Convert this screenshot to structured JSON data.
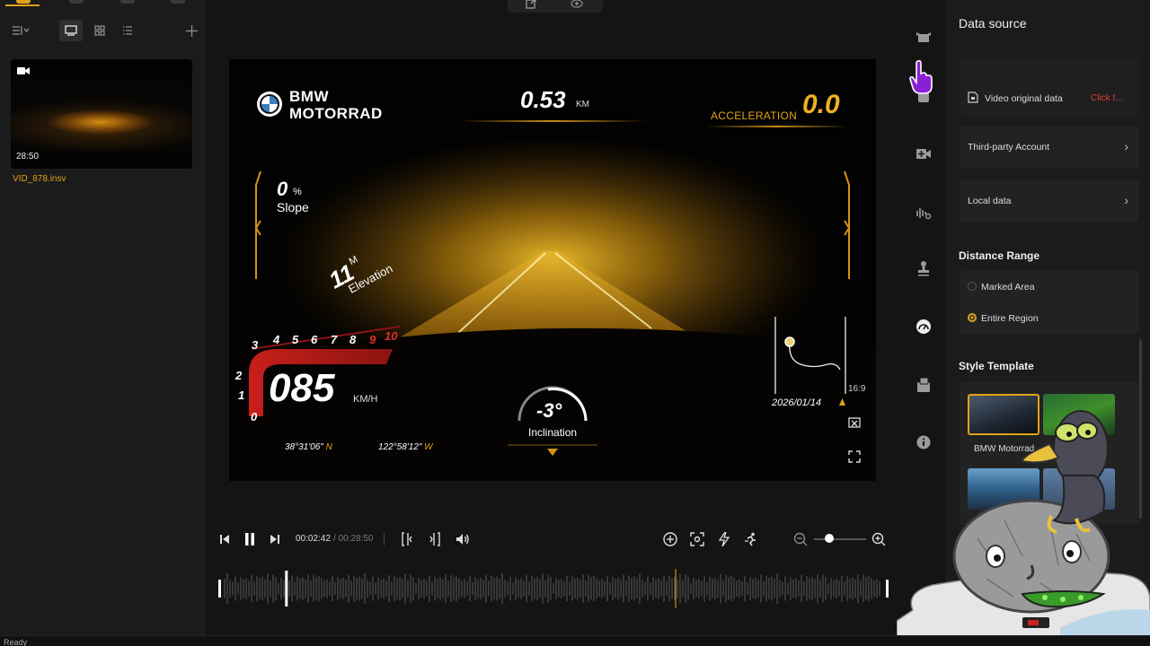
{
  "media_panel": {
    "clip": {
      "duration": "28:50",
      "filename": "VID_878.insv"
    }
  },
  "preview": {
    "brand_line1": "BMW",
    "brand_line2": "MOTORRAD",
    "distance": {
      "value": "0.53",
      "unit": "KM"
    },
    "acceleration": {
      "label": "ACCELERATION",
      "value": "0.0"
    },
    "slope": {
      "value": "0",
      "unit": "%",
      "label": "Slope"
    },
    "elevation": {
      "value": "11",
      "unit": "M",
      "label": "Elevation"
    },
    "speed": {
      "value": "085",
      "unit": "KM/H"
    },
    "gauge_ticks": [
      "0",
      "1",
      "2",
      "3",
      "4",
      "5",
      "6",
      "7",
      "8",
      "9",
      "10"
    ],
    "coordinates": {
      "lat": "38°31'06\"",
      "lat_dir": "N",
      "lon": "122°58'12\"",
      "lon_dir": "W"
    },
    "inclination": {
      "value": "-3°",
      "label": "Inclination"
    },
    "date": "2026/01/14",
    "aspect_ratio": "16:9"
  },
  "player": {
    "time_current": "00:02:42",
    "time_total": "/ 00:28:50",
    "progress": 0.094,
    "zoom_level": 0.3
  },
  "settings": {
    "data_source_title": "Data source",
    "video_original_data": {
      "label": "Video original data",
      "link": "Click t..."
    },
    "third_party_account": "Third-party Account",
    "local_data": "Local data",
    "distance_range_title": "Distance Range",
    "distance_range_options": [
      {
        "label": "Marked Area",
        "selected": false
      },
      {
        "label": "Entire Region",
        "selected": true
      }
    ],
    "style_template_title": "Style Template",
    "templates": [
      {
        "label": "BMW Motorrad",
        "selected": true
      }
    ]
  },
  "status_bar": {
    "text": "Ready"
  },
  "colors": {
    "accent": "#e1a318",
    "danger": "#e0403a",
    "background": "#141414",
    "panel": "#1b1b1b"
  }
}
